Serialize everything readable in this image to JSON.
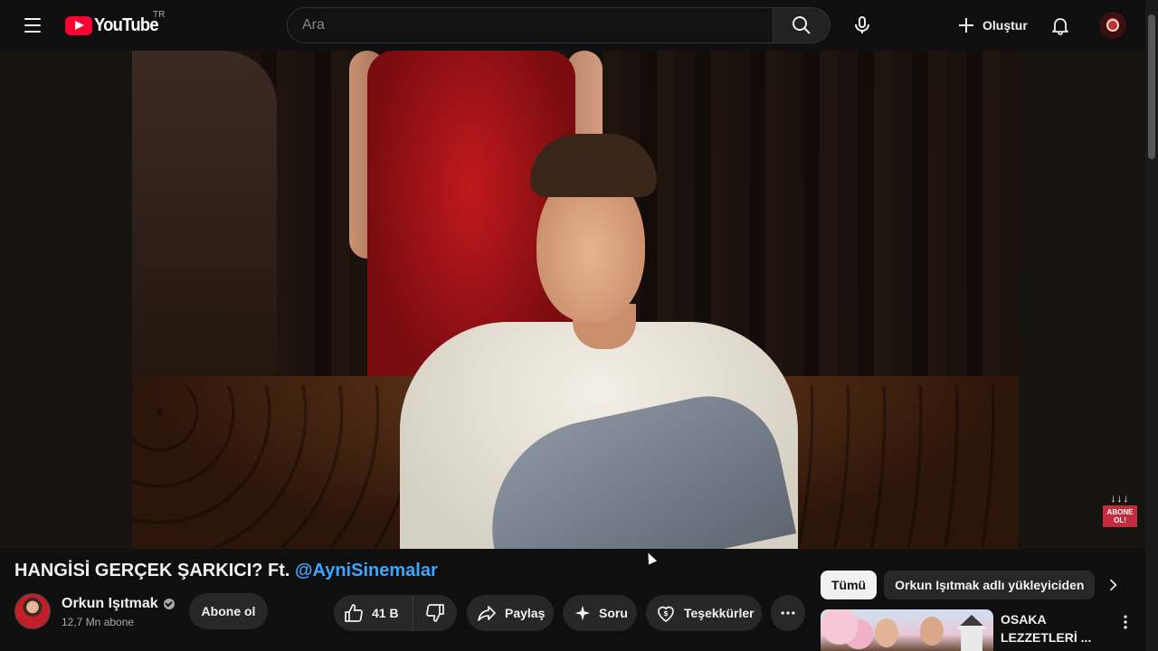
{
  "masthead": {
    "logo_text": "YouTube",
    "region": "TR",
    "search_placeholder": "Ara",
    "create_label": "Oluştur",
    "icons": [
      "menu-icon",
      "search-icon",
      "microphone-icon",
      "plus-icon",
      "bell-icon",
      "avatar"
    ]
  },
  "player": {
    "overlay_arrows": "↓↓↓",
    "overlay_badge": "ABONE OL!"
  },
  "video": {
    "title_main": "HANGİSİ GERÇEK ŞARKICI? Ft. ",
    "title_mention": "@AyniSinemalar",
    "channel_name": "Orkun Işıtmak",
    "subscribers": "12,7 Mn abone",
    "subscribe_label": "Abone ol",
    "likes": "41 B",
    "share_label": "Paylaş",
    "ask_label": "Soru",
    "thanks_label": "Teşekkürler"
  },
  "sidebar": {
    "chips": [
      {
        "label": "Tümü",
        "active": true
      },
      {
        "label": "Orkun Işıtmak adlı yükleyiciden",
        "active": false
      }
    ],
    "recommendation": {
      "title": "OSAKA LEZZETLERİ ..."
    }
  },
  "colors": {
    "background": "#0f0f0f",
    "brand_red": "#ff0033",
    "mention_blue": "#3ea6ff",
    "button_bg": "#272727"
  }
}
